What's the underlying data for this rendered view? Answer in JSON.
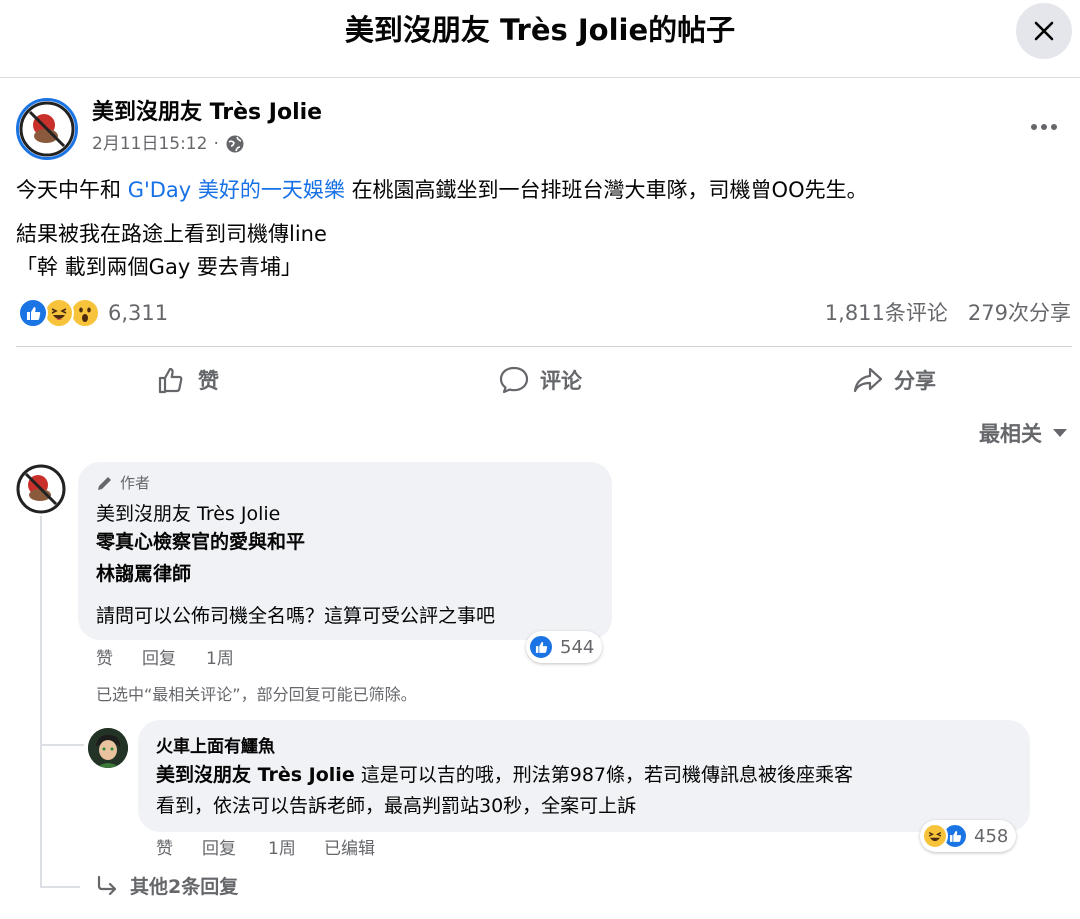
{
  "header": {
    "title": "美到沒朋友 Très Jolie的帖子",
    "close_icon": "close-icon"
  },
  "post": {
    "author": "美到沒朋友 Très Jolie",
    "date": "2月11日15:12",
    "meta_separator": "·",
    "privacy_icon": "globe-icon",
    "line1_prefix": "今天中午和",
    "line1_link": "G'Day 美好的一天娛樂",
    "line1_suffix": "在桃園高鐵坐到一台排班台灣大車隊，司機曾OO先生。",
    "line2": "結果被我在路途上看到司機傳line",
    "line3": "「幹 載到兩個Gay 要去青埔」",
    "reaction_count": "6,311",
    "comment_count": "1,811条评论",
    "share_count": "279次分享"
  },
  "actions": {
    "like": "赞",
    "comment": "评论",
    "share": "分享"
  },
  "sort": {
    "label": "最相关"
  },
  "comment1": {
    "badge": "作者",
    "author": "美到沒朋友 Très Jolie",
    "tag1": "零真心檢察官的愛與和平",
    "tag2": "林謅罵律師",
    "text": "請問可以公佈司機全名嗎？這算可受公評之事吧",
    "reaction_count": "544",
    "like": "赞",
    "reply": "回复",
    "time": "1周"
  },
  "filter_note": "已选中“最相关评论”，部分回复可能已筛除。",
  "reply1": {
    "author": "火車上面有鱷魚",
    "mention": "美到沒朋友 Très Jolie",
    "text1": "這是可以吉的哦，刑法第987條，若司機傳訊息被後座乘客",
    "text2": "看到，依法可以告訴老師，最高判罰站30秒，全案可上訴",
    "reaction_count": "458",
    "like": "赞",
    "reply": "回复",
    "time": "1周",
    "edited": "已编辑"
  },
  "more_replies": "其他2条回复",
  "colors": {
    "link": "#1771e6",
    "like_blue": "#1b74e4",
    "haha_yellow": "#f7c33a",
    "gray_text": "#65676b"
  }
}
